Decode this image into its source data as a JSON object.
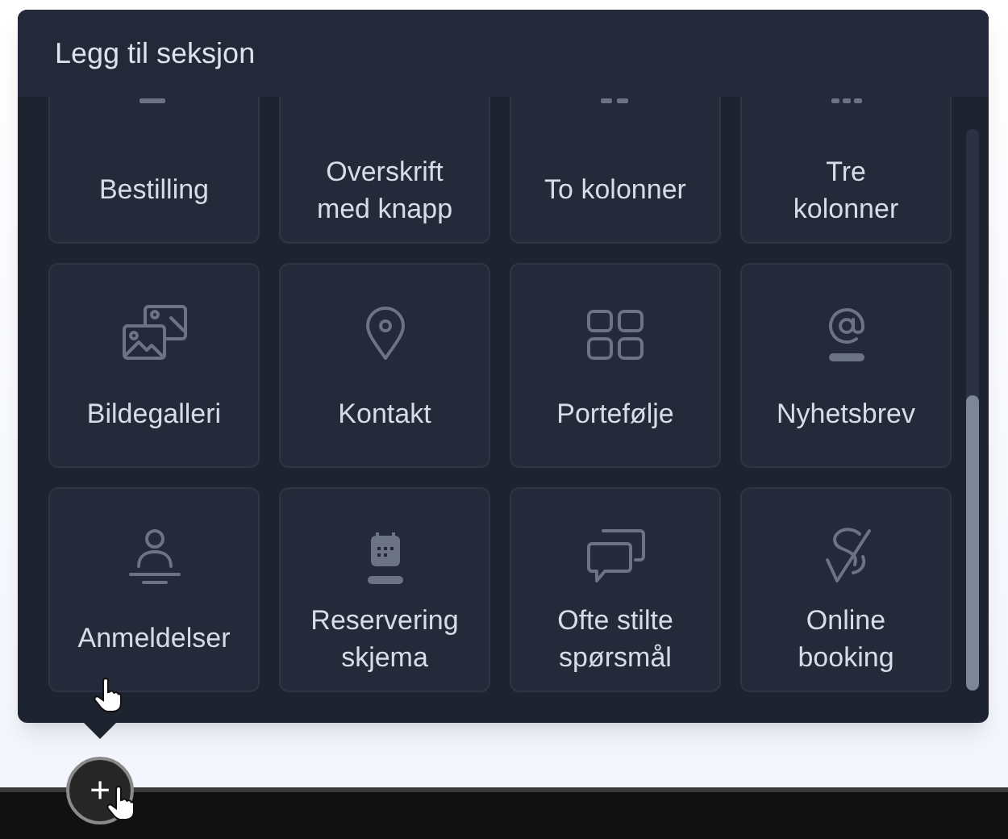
{
  "panel": {
    "title": "Legg til seksjon"
  },
  "sections": [
    {
      "label": "Bestilling",
      "kind": "order"
    },
    {
      "label": "Overskrift med knapp",
      "kind": "heading-button"
    },
    {
      "label": "To kolonner",
      "kind": "two-columns"
    },
    {
      "label": "Tre kolonner",
      "kind": "three-columns"
    },
    {
      "label": "Bildegalleri",
      "kind": "gallery"
    },
    {
      "label": "Kontakt",
      "kind": "contact"
    },
    {
      "label": "Portefølje",
      "kind": "portfolio"
    },
    {
      "label": "Nyhetsbrev",
      "kind": "newsletter"
    },
    {
      "label": "Anmeldelser",
      "kind": "reviews"
    },
    {
      "label": "Reservering skjema",
      "kind": "reservation"
    },
    {
      "label": "Ofte stilte spørsmål",
      "kind": "faq"
    },
    {
      "label": "Online booking",
      "kind": "booking"
    }
  ],
  "add_button": {
    "label": "+"
  }
}
